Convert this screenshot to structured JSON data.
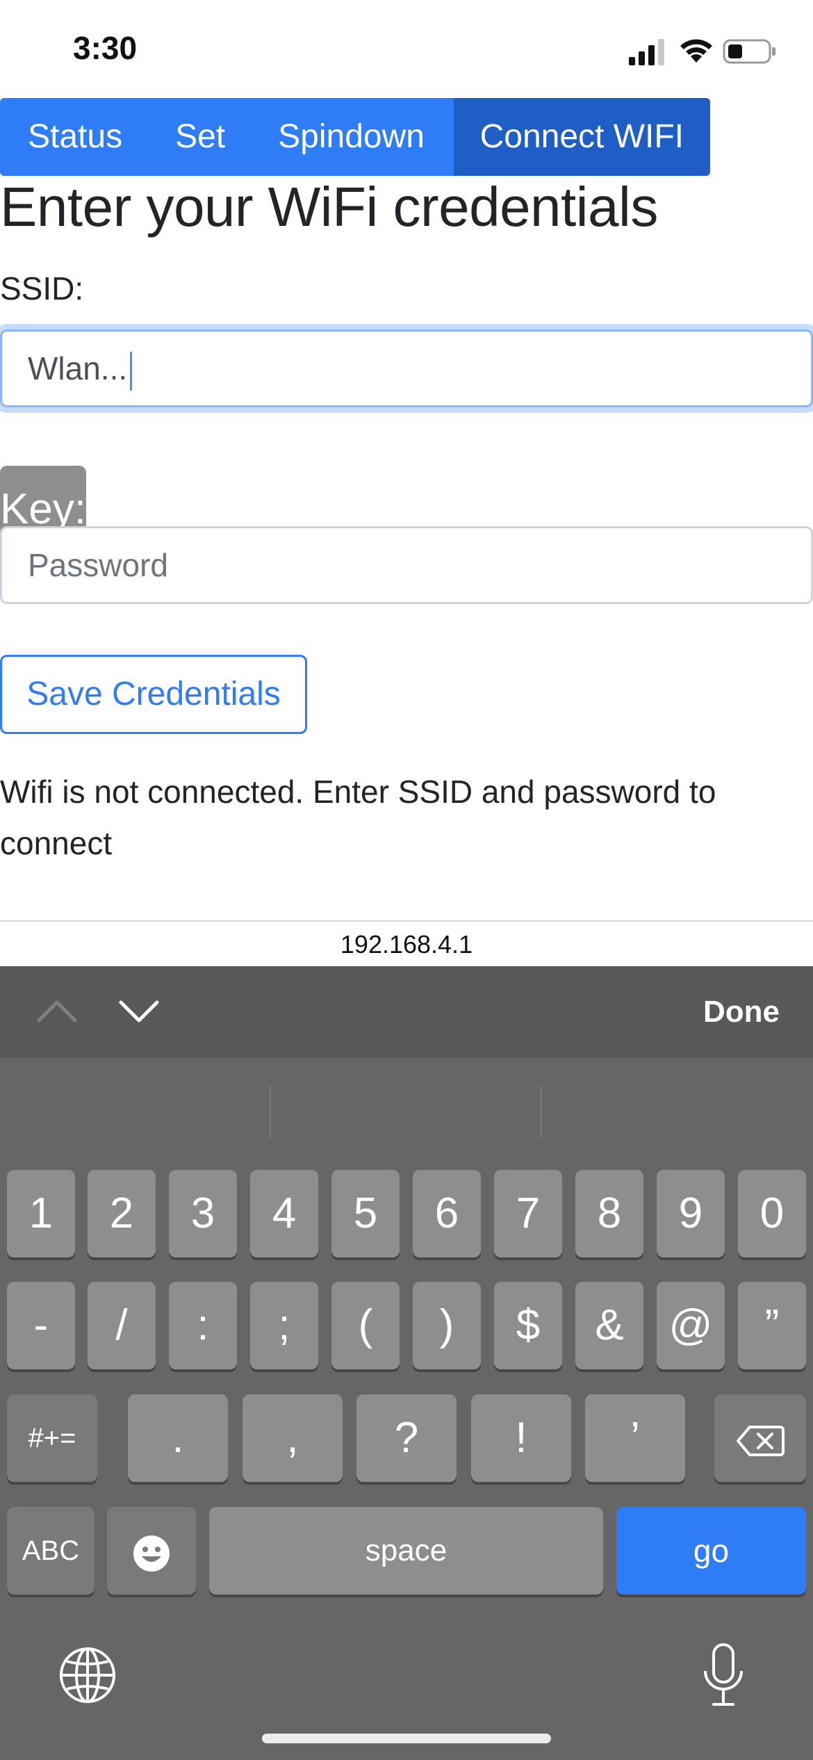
{
  "status_bar": {
    "time": "3:30"
  },
  "nav": {
    "items": [
      {
        "label": "Status"
      },
      {
        "label": "Set"
      },
      {
        "label": "Spindown"
      },
      {
        "label": "Connect WIFI"
      }
    ],
    "active_index": 3
  },
  "form": {
    "heading": "Enter your WiFi credentials",
    "ssid_label": "SSID:",
    "ssid_value": "Wlan...",
    "key_label": "Key:",
    "key_placeholder": "Password",
    "save_label": "Save Credentials"
  },
  "message": "Wifi is not connected. Enter SSID and password to connect",
  "url": "192.168.4.1",
  "keyboard": {
    "done_label": "Done",
    "row1": [
      "1",
      "2",
      "3",
      "4",
      "5",
      "6",
      "7",
      "8",
      "9",
      "0"
    ],
    "row2": [
      "-",
      "/",
      ":",
      ";",
      "(",
      ")",
      "$",
      "&",
      "@",
      "”"
    ],
    "row3_mode": "#+=",
    "row3": [
      ".",
      ",",
      "?",
      "!",
      "’"
    ],
    "abc_label": "ABC",
    "space_label": "space",
    "go_label": "go"
  },
  "colors": {
    "accent": "#2f7df6",
    "nav_active": "#1f5fc5",
    "keyboard_bg": "#666666",
    "key_bg": "#8e8e8e"
  }
}
